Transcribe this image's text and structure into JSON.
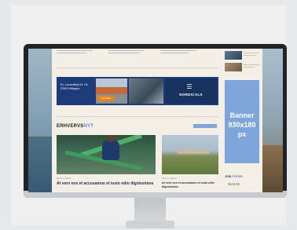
{
  "ad_banner": {
    "text": "Kl. Louenthal Kl. Fk\nFDEI Hilleges",
    "cta": "For Salg",
    "brand": "NORDICALS"
  },
  "section": {
    "title_main": "ERHVERVS",
    "title_accent": "NYT"
  },
  "articles": [
    {
      "meta": "Erhverv  |  Nyhed",
      "headline": "At vero eos et accusamus et iusto odio dignissimos"
    },
    {
      "meta": "Erhverv  |  Nyhed",
      "headline": "At vero eos et accusamus et iusto odio dignissimos"
    }
  ],
  "sidebar": {
    "banner_line1": "Banner",
    "banner_line2": "930x180",
    "banner_line3": "px",
    "job_main": "JOB",
    "job_accent": "FRUEN",
    "partner": "SKALES"
  },
  "colors": {
    "accent_blue": "#5b8bd0",
    "ad_navy": "#1c3b78",
    "cta_orange": "#e2871f",
    "banner_blue": "#7ea5d9"
  }
}
